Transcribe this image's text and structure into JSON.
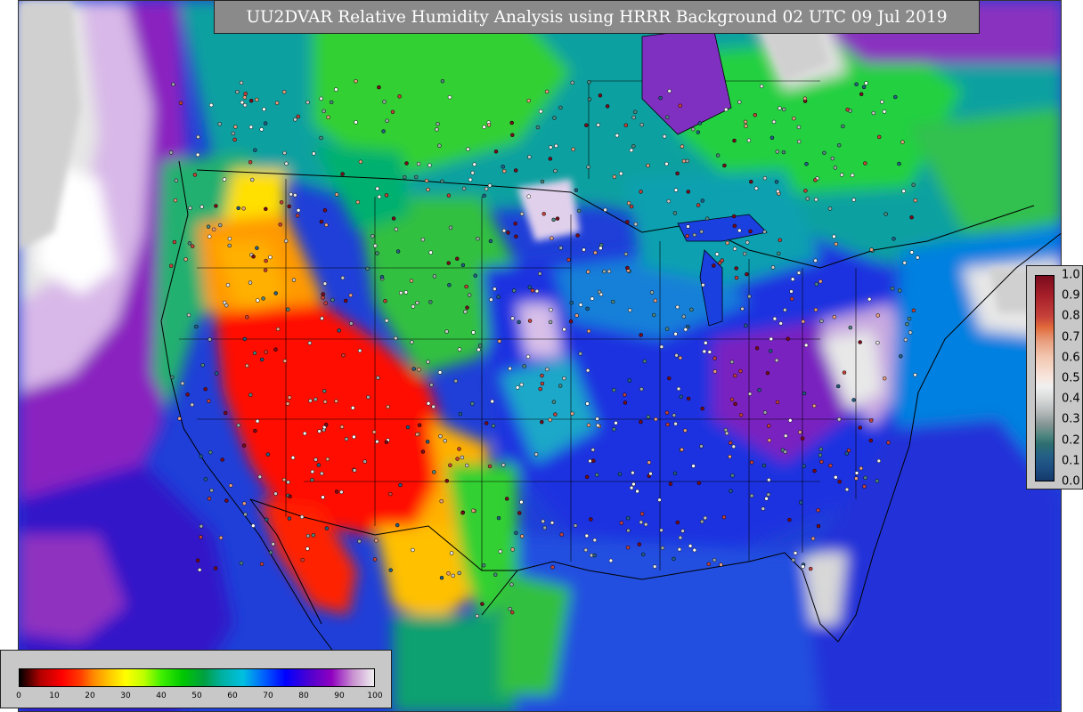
{
  "title": "UU2DVAR Relative Humidity Analysis using HRRR Background 02 UTC 09 Jul 2019",
  "observation_colorbar": {
    "tick_labels": [
      "1.0",
      "0.9",
      "0.8",
      "0.7",
      "0.6",
      "0.5",
      "0.4",
      "0.3",
      "0.2",
      "0.1",
      "0.0"
    ]
  },
  "humidity_colorbar": {
    "tick_labels": [
      "0",
      "10",
      "20",
      "30",
      "40",
      "50",
      "60",
      "70",
      "80",
      "90",
      "100"
    ],
    "range": [
      0,
      100
    ]
  },
  "colors": {
    "very_dry": "#ff0000",
    "dry": "#ffa500",
    "moderate": "#00c800",
    "moist": "#0000ff",
    "saturated": "#9000c0",
    "cloud_gray": "#d0d0d0",
    "title_box": "#8a8a8a",
    "legend_box": "#c8c8c8"
  }
}
